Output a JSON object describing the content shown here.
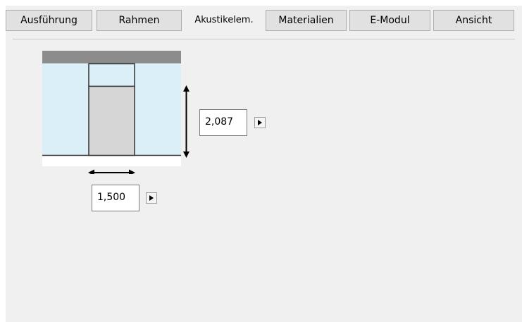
{
  "tabs": [
    {
      "label": "Ausführung",
      "active": false
    },
    {
      "label": "Rahmen",
      "active": false
    },
    {
      "label": "Akustikelem.",
      "active": true
    },
    {
      "label": "Materialien",
      "active": false
    },
    {
      "label": "E-Modul",
      "active": false
    },
    {
      "label": "Ansicht",
      "active": false
    }
  ],
  "dimensions": {
    "height_value": "2,087",
    "width_value": "1,500"
  },
  "icons": {
    "spin": "play-right-icon",
    "height_arrow": "vertical-double-arrow-icon",
    "width_arrow": "horizontal-double-arrow-icon"
  },
  "colors": {
    "panel_bg": "#f0f0f0",
    "tab_bg": "#e1e1e1",
    "sky": "#dbeff9",
    "element_fill": "#d6d6d6",
    "header_bar": "#8c8c8c"
  }
}
